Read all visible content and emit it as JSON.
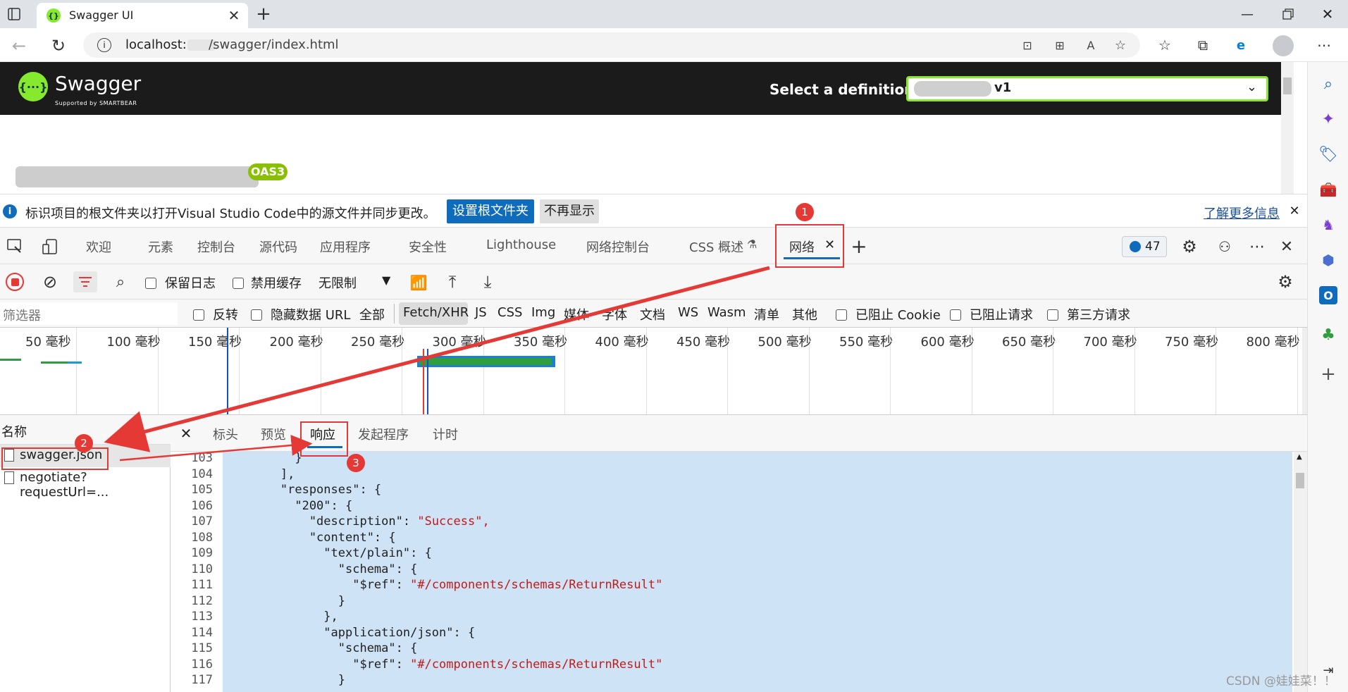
{
  "browser": {
    "tab_title": "Swagger UI",
    "url": "localhost:",
    "url_rest": "/swagger/index.html"
  },
  "swagger": {
    "logo_text": "Swagger",
    "logo_sub": "Supported by SMARTBEAR",
    "select_label": "Select a definition",
    "select_value": "v1",
    "oas_badge": "OAS3"
  },
  "infobar": {
    "message": "标识项目的根文件夹以打开Visual Studio Code中的源文件并同步更改。",
    "set_root_button": "设置根文件夹",
    "dont_show_button": "不再显示",
    "learn_more": "了解更多信息"
  },
  "devtools": {
    "tabs": [
      "欢迎",
      "元素",
      "控制台",
      "源代码",
      "应用程序",
      "安全性",
      "Lighthouse",
      "网络控制台",
      "CSS 概述"
    ],
    "active_tab": "网络",
    "issue_count": "47",
    "toolbar": {
      "preserve_log": "保留日志",
      "disable_cache": "禁用缓存",
      "throttle": "无限制"
    },
    "filter": {
      "placeholder": "筛选器",
      "invert": "反转",
      "hide_data_url": "隐藏数据 URL",
      "all": "全部",
      "types": [
        "Fetch/XHR",
        "JS",
        "CSS",
        "Img",
        "媒体",
        "字体",
        "文档",
        "WS",
        "Wasm",
        "清单",
        "其他"
      ],
      "blocked_cookies": "已阻止 Cookie",
      "blocked_requests": "已阻止请求",
      "third_party": "第三方请求"
    },
    "timeline_ticks": [
      "50 毫秒",
      "100 毫秒",
      "150 毫秒",
      "200 毫秒",
      "250 毫秒",
      "300 毫秒",
      "350 毫秒",
      "400 毫秒",
      "450 毫秒",
      "500 毫秒",
      "550 毫秒",
      "600 毫秒",
      "650 毫秒",
      "700 毫秒",
      "750 毫秒",
      "800 毫秒"
    ],
    "list_header": "名称",
    "requests": [
      "swagger.json",
      "negotiate?requestUrl=..."
    ],
    "detail_tabs": [
      "标头",
      "预览",
      "响应",
      "发起程序",
      "计时"
    ],
    "active_detail_tab": "响应"
  },
  "code": {
    "line_numbers": [
      "103",
      "104",
      "105",
      "106",
      "107",
      "108",
      "109",
      "110",
      "111",
      "112",
      "113",
      "114",
      "115",
      "116",
      "117"
    ],
    "lines": [
      "          }",
      "        ],",
      "        \"responses\": {",
      "          \"200\": {",
      "            \"description\": ",
      "            \"content\": {",
      "              \"text/plain\": {",
      "                \"schema\": {",
      "                  \"$ref\": ",
      "                }",
      "              },",
      "              \"application/json\": {",
      "                \"schema\": {",
      "                  \"$ref\": ",
      "                }"
    ],
    "strings": {
      "description": "\"Success\",",
      "ref1": "\"#/components/schemas/ReturnResult\"",
      "ref2": "\"#/components/schemas/ReturnResult\""
    }
  },
  "annotations": [
    "1",
    "2",
    "3"
  ],
  "watermark": "CSDN @娃娃菜！！",
  "colors": {
    "swagger_green": "#85ea2d",
    "header_bg": "#1b1b1b",
    "highlight_bg": "#cfe3f7",
    "annotation_red": "#e53935",
    "string_red": "#c41a16",
    "link_blue": "#1a73e8",
    "button_blue": "#0f6cbd"
  }
}
